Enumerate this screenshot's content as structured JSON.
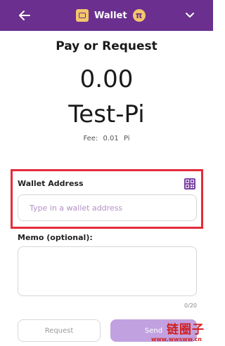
{
  "header": {
    "title": "Wallet",
    "pi_symbol": "π",
    "colors": {
      "bar": "#6a2f8f",
      "badge": "#f3c66b"
    },
    "icons": [
      "back-arrow-icon",
      "wallet-icon",
      "pi-icon",
      "chevron-down-icon"
    ]
  },
  "main": {
    "heading": "Pay or Request",
    "amount": "0.00",
    "currency": "Test-Pi",
    "fee": {
      "label": "Fee:",
      "value": "0.01",
      "unit": "Pi"
    }
  },
  "form": {
    "wallet_address": {
      "label": "Wallet Address",
      "value": "",
      "placeholder": "Type in a wallet address",
      "icon": "qr-code-icon"
    },
    "memo": {
      "label": "Memo (optional):",
      "value": "",
      "placeholder": "",
      "counter": "0/20"
    }
  },
  "actions": {
    "request_label": "Request",
    "send_label": "Send",
    "accent": "#c2a1e0"
  },
  "overlays": {
    "highlight_color": "#e32c3b",
    "watermark_top": "链圈子",
    "watermark_bottom": "www.wwsww.cn"
  }
}
